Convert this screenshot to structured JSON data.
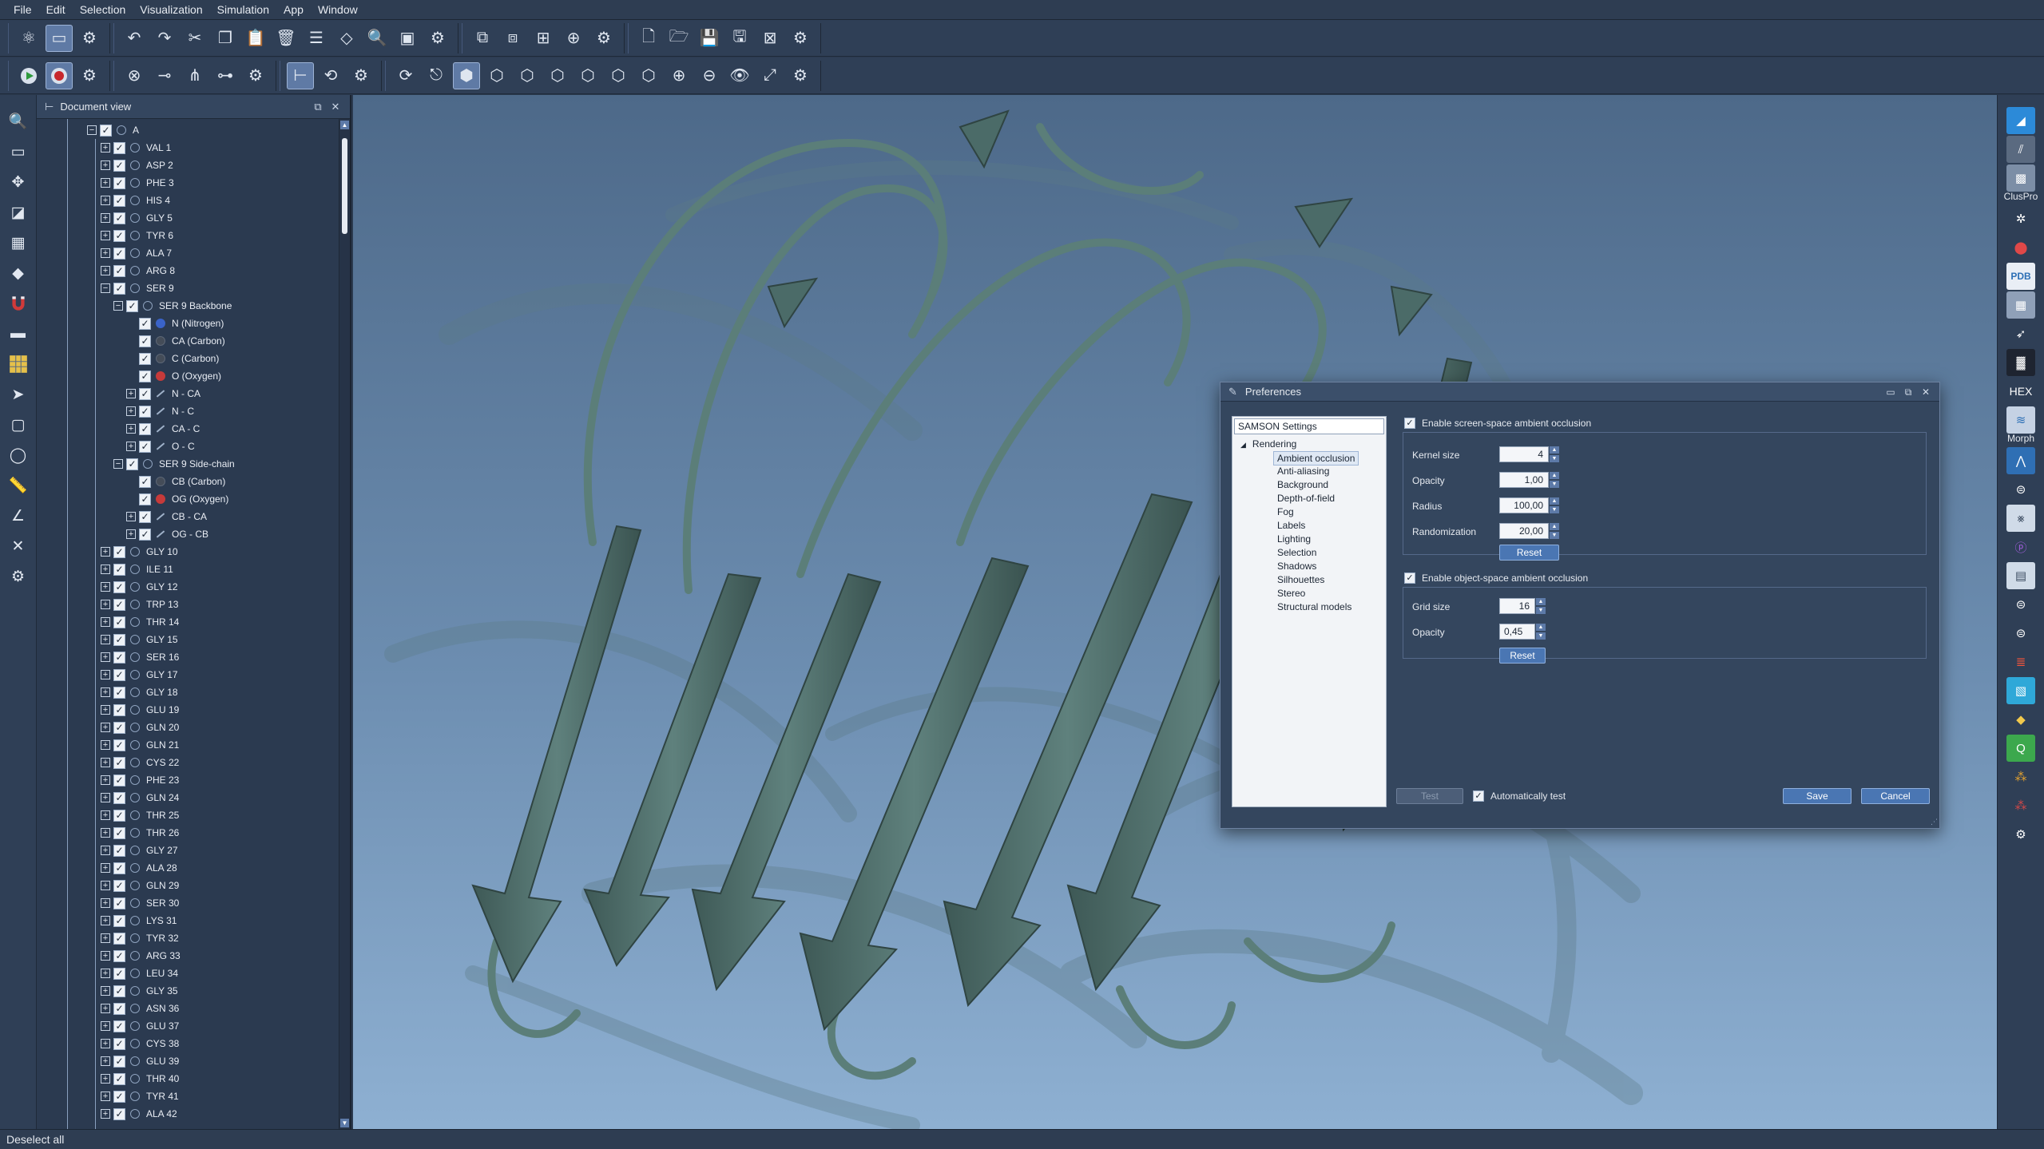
{
  "menubar": {
    "items": [
      "File",
      "Edit",
      "Selection",
      "Visualization",
      "Simulation",
      "App",
      "Window"
    ]
  },
  "docview": {
    "title": "Document view",
    "root": "A",
    "residues_before": [
      "VAL 1",
      "ASP 2",
      "PHE 3",
      "HIS 4",
      "GLY 5",
      "TYR 6",
      "ALA 7",
      "ARG 8"
    ],
    "expanded_residue": "SER 9",
    "backbone": {
      "label": "SER 9 Backbone",
      "atoms": [
        "N (Nitrogen)",
        "CA (Carbon)",
        "C (Carbon)",
        "O (Oxygen)"
      ],
      "bonds": [
        "N - CA",
        "N - C",
        "CA - C",
        "O - C"
      ]
    },
    "sidechain": {
      "label": "SER 9 Side-chain",
      "atoms": [
        "CB (Carbon)",
        "OG (Oxygen)"
      ],
      "bonds": [
        "CB - CA",
        "OG - CB"
      ]
    },
    "residues_after": [
      "GLY 10",
      "ILE 11",
      "GLY 12",
      "TRP 13",
      "THR 14",
      "GLY 15",
      "SER 16",
      "GLY 17",
      "GLY 18",
      "GLU 19",
      "GLN 20",
      "GLN 21",
      "CYS 22",
      "PHE 23",
      "GLN 24",
      "THR 25",
      "THR 26",
      "GLY 27",
      "ALA 28",
      "GLN 29",
      "SER 30",
      "LYS 31",
      "TYR 32",
      "ARG 33",
      "LEU 34",
      "GLY 35",
      "ASN 36",
      "GLU 37",
      "CYS 38",
      "GLU 39",
      "THR 40",
      "TYR 41",
      "ALA 42"
    ]
  },
  "right_tools": {
    "labels": [
      "ClusPro",
      "PDB",
      "HEX",
      "Morph"
    ]
  },
  "preferences": {
    "title": "Preferences",
    "tree": {
      "root": "SAMSON Settings",
      "category": "Rendering",
      "items": [
        "Ambient occlusion",
        "Anti-aliasing",
        "Background",
        "Depth-of-field",
        "Fog",
        "Labels",
        "Lighting",
        "Selection",
        "Shadows",
        "Silhouettes",
        "Stereo",
        "Structural models"
      ],
      "selected": "Ambient occlusion"
    },
    "ssao": {
      "label": "Enable screen-space ambient occlusion",
      "enabled": true,
      "kernel_size_label": "Kernel size",
      "kernel_size": "4",
      "opacity_label": "Opacity",
      "opacity": "1,00",
      "radius_label": "Radius",
      "radius": "100,00",
      "randomization_label": "Randomization",
      "randomization": "20,00",
      "reset_label": "Reset"
    },
    "osao": {
      "label": "Enable object-space ambient occlusion",
      "enabled": true,
      "grid_size_label": "Grid size",
      "grid_size": "16",
      "opacity_label": "Opacity",
      "opacity": "0,45",
      "reset_label": "Reset"
    },
    "test_label": "Test",
    "auto_test_label": "Automatically test",
    "save_label": "Save",
    "cancel_label": "Cancel"
  },
  "statusbar": {
    "text": "Deselect all"
  },
  "colors": {
    "background": "#2b3a4f",
    "accent": "#4a76b3",
    "ribbon": "#4f706d"
  }
}
